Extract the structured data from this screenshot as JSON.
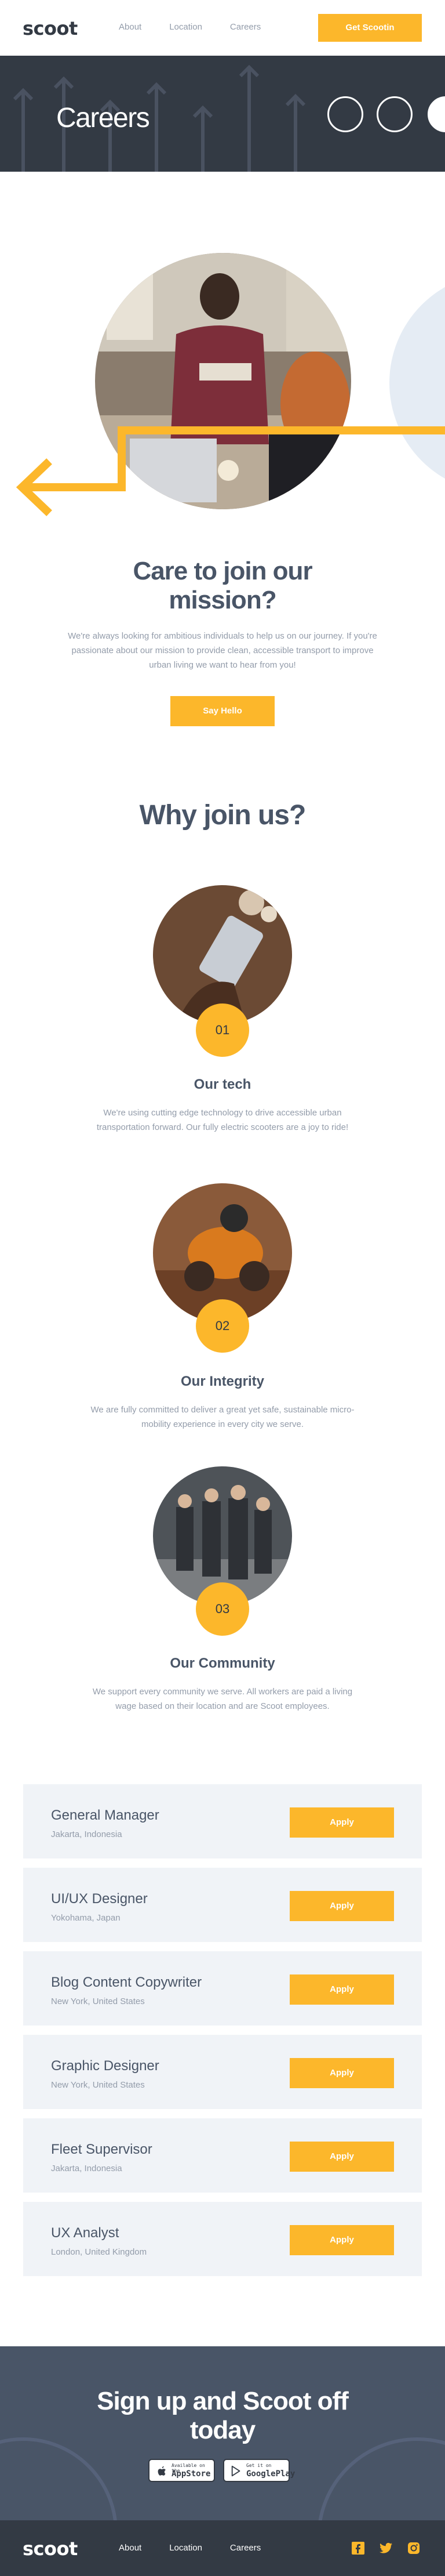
{
  "header": {
    "logo": "scoot",
    "nav": [
      "About",
      "Location",
      "Careers"
    ],
    "cta": "Get Scootin"
  },
  "hero": {
    "title": "Careers"
  },
  "mission": {
    "title": "Care to join our mission?",
    "text": "We're always looking for ambitious individuals to help us on our journey. If you're passionate about our mission to provide clean, accessible transport to improve urban living we want to hear from you!",
    "button": "Say Hello"
  },
  "why": {
    "title": "Why join us?",
    "features": [
      {
        "num": "01",
        "title": "Our tech",
        "text": "We're using cutting edge technology to drive accessible urban transportation forward. Our fully electric scooters are a joy to ride!"
      },
      {
        "num": "02",
        "title": "Our Integrity",
        "text": "We are fully committed to deliver a great yet safe, sustainable micro-mobility experience in every city we serve."
      },
      {
        "num": "03",
        "title": "Our Community",
        "text": "We support every community we serve. All workers are paid a living wage based on their location and are Scoot employees."
      }
    ]
  },
  "jobs": [
    {
      "title": "General Manager",
      "location": "Jakarta, Indonesia",
      "apply": "Apply"
    },
    {
      "title": "UI/UX Designer",
      "location": "Yokohama, Japan",
      "apply": "Apply"
    },
    {
      "title": "Blog Content Copywriter",
      "location": "New York, United States",
      "apply": "Apply"
    },
    {
      "title": "Graphic Designer",
      "location": "New York, United States",
      "apply": "Apply"
    },
    {
      "title": "Fleet Supervisor",
      "location": "Jakarta, Indonesia",
      "apply": "Apply"
    },
    {
      "title": "UX Analyst",
      "location": "London, United Kingdom",
      "apply": "Apply"
    }
  ],
  "signup": {
    "title": "Sign up and Scoot off today",
    "appstore": {
      "small": "Available on the",
      "large": "AppStore"
    },
    "googleplay": {
      "small": "Get it on",
      "large": "GooglePlay"
    }
  },
  "footer": {
    "logo": "scoot",
    "nav": [
      "About",
      "Location",
      "Careers"
    ]
  },
  "colors": {
    "accent": "#fcb72b",
    "dark": "#333a44",
    "slate": "#495567",
    "muted": "#939caa",
    "light": "#f0f3f7"
  },
  "icons": [
    "facebook-icon",
    "twitter-icon",
    "instagram-icon",
    "arrow-left-icon",
    "apple-icon",
    "google-play-icon"
  ]
}
